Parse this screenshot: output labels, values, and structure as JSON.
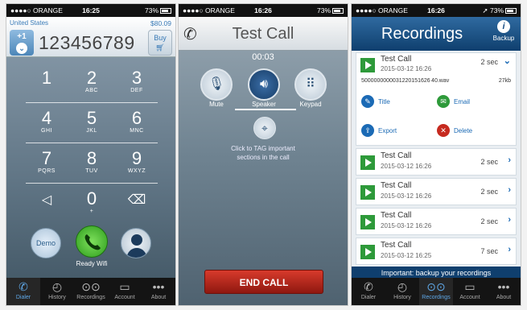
{
  "status": {
    "carrier": "●●●●○ ORANGE",
    "battery": "73%",
    "times": [
      "16:25",
      "16:26",
      "16:26"
    ]
  },
  "dialer": {
    "country": "United States",
    "credit": "$80.09",
    "country_code": "+1",
    "number": "123456789",
    "buy_label": "Buy",
    "keys": [
      {
        "digit": "1",
        "letters": ""
      },
      {
        "digit": "2",
        "letters": "ABC"
      },
      {
        "digit": "3",
        "letters": "DEF"
      },
      {
        "digit": "4",
        "letters": "GHI"
      },
      {
        "digit": "5",
        "letters": "JKL"
      },
      {
        "digit": "6",
        "letters": "MNC"
      },
      {
        "digit": "7",
        "letters": "PQRS"
      },
      {
        "digit": "8",
        "letters": "TUV"
      },
      {
        "digit": "9",
        "letters": "WXYZ"
      },
      {
        "digit": "0",
        "letters": "+"
      }
    ],
    "demo_label": "Demo",
    "ready_text": "Ready Wifi"
  },
  "call": {
    "title": "Test Call",
    "timer": "00:03",
    "controls": [
      "Mute",
      "Speaker",
      "Keypad"
    ],
    "tag_text_line1": "Click to TAG important",
    "tag_text_line2": "sections in the call",
    "end_call_label": "END CALL"
  },
  "recordings": {
    "title": "Recordings",
    "backup_label": "Backup",
    "expanded": {
      "name": "Test Call",
      "date": "2015-03-12 16:26",
      "duration": "2 sec",
      "file_name": "5000000000031220151626 40.wav",
      "file_size": "27kb",
      "actions": [
        "Title",
        "Email",
        "Export",
        "Delete"
      ]
    },
    "items": [
      {
        "name": "Test Call",
        "date": "2015-03-12 16:26",
        "duration": "2 sec"
      },
      {
        "name": "Test Call",
        "date": "2015-03-12 16:26",
        "duration": "2 sec"
      },
      {
        "name": "Test Call",
        "date": "2015-03-12 16:26",
        "duration": "2 sec"
      },
      {
        "name": "Test Call",
        "date": "2015-03-12 16:25",
        "duration": "7 sec"
      }
    ],
    "footer_note": "Important: backup your recordings"
  },
  "tabs": [
    "Dialer",
    "History",
    "Recordings",
    "Account",
    "About"
  ],
  "colors": {
    "accent_blue": "#1b6ab5",
    "end_call_red": "#c62a1f",
    "play_green": "#2e9a3a",
    "header_navy": "#0f3f6e"
  }
}
